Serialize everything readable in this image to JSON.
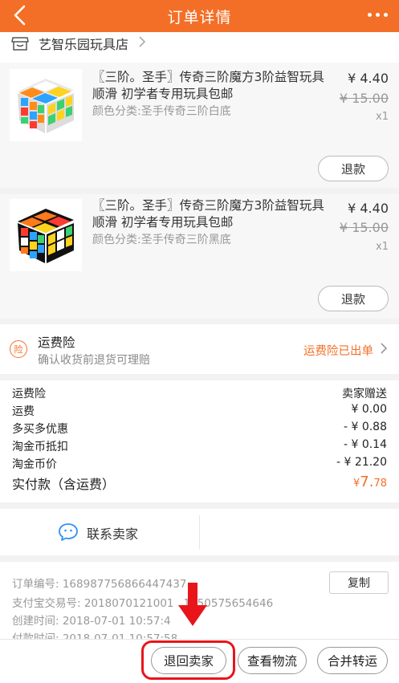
{
  "header": {
    "title": "订单详情",
    "back_icon": "back-chevron-icon",
    "more_icon": "more-dots-icon"
  },
  "shop": {
    "name": "艺智乐园玩具店",
    "icon": "store-icon"
  },
  "items": [
    {
      "name": "〖三阶。圣手〗传奇三阶魔方3阶益智玩具顺滑 初学者专用玩具包邮",
      "spec": "颜色分类:圣手传奇三阶白底",
      "price": "¥ 4.40",
      "original_price": "¥ 15.00",
      "qty": "x1",
      "refund_label": "退款"
    },
    {
      "name": "〖三阶。圣手〗传奇三阶魔方3阶益智玩具顺滑 初学者专用玩具包邮",
      "spec": "颜色分类:圣手传奇三阶黑底",
      "price": "¥ 4.40",
      "original_price": "¥ 15.00",
      "qty": "x1",
      "refund_label": "退款"
    }
  ],
  "insurance": {
    "badge": "险",
    "title": "运费险",
    "subtitle": "确认收货前退货可理赔",
    "status": "运费险已出单"
  },
  "costs": [
    {
      "label": "运费险",
      "value": "卖家赠送"
    },
    {
      "label": "运费",
      "value": "¥ 0.00"
    },
    {
      "label": "多买多优惠",
      "value": "- ¥ 0.88"
    },
    {
      "label": "淘金币抵扣",
      "value": "- ¥ 0.14"
    },
    {
      "label": "淘金币价",
      "value": "- ¥ 21.20"
    }
  ],
  "total": {
    "label": "实付款（含运费）",
    "symbol": "¥",
    "int_part": "7.",
    "dec_part": "78"
  },
  "contact": {
    "label": "联系卖家",
    "icon": "chat-bubble-icon"
  },
  "order_info": {
    "order_no": "订单编号:  1689877568664474",
    "order_no_tail": "37",
    "alipay_no": "支付宝交易号:  2018070121001",
    "alipay_no_tail": "1850575654646",
    "created": "创建时间:  2018-07-01 10:57:4",
    "paid": "付款时间:  2018-07-01 10:57:58",
    "copy_label": "复制"
  },
  "actions": {
    "return": "退回卖家",
    "logistics": "查看物流",
    "merge": "合并转运"
  },
  "annotation": {
    "arrow_color": "#e8151b",
    "box_color": "#e8151b"
  },
  "colors": {
    "brand": "#f36f27",
    "background": "#f2f2f2"
  }
}
